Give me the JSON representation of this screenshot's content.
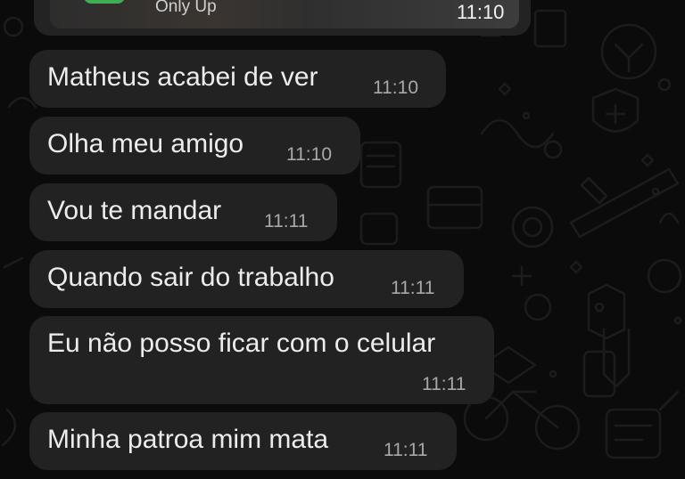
{
  "media": {
    "caption": "Only Up",
    "time": "11:10"
  },
  "messages": [
    {
      "text": "Matheus acabei de ver",
      "time": "11:10"
    },
    {
      "text": "Olha meu amigo",
      "time": "11:10"
    },
    {
      "text": "Vou te mandar",
      "time": "11:11"
    },
    {
      "text": "Quando sair do trabalho",
      "time": "11:11"
    },
    {
      "text": "Eu não posso ficar com o celular",
      "time": "11:11"
    },
    {
      "text": "Minha patroa mim mata",
      "time": "11:11"
    }
  ],
  "colors": {
    "background": "#0b0b0b",
    "bubble": "#222222",
    "text": "#ececec",
    "time": "#a8a8a8"
  }
}
